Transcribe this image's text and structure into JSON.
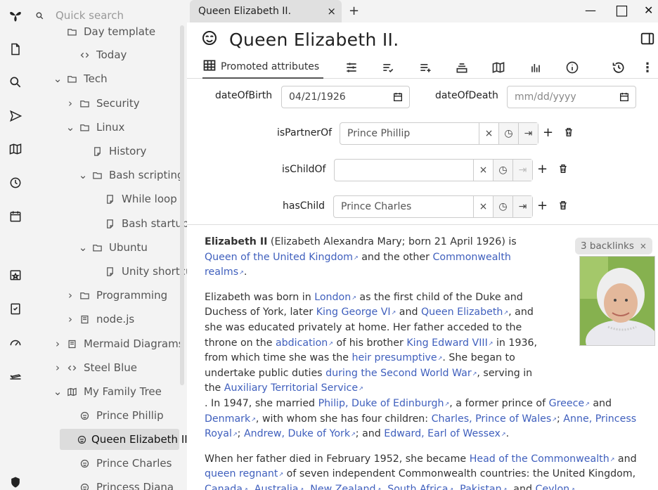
{
  "search": {
    "placeholder": "Quick search"
  },
  "tree": {
    "items": [
      {
        "label": "Day template"
      },
      {
        "label": "Today"
      },
      {
        "label": "Tech"
      },
      {
        "label": "Security"
      },
      {
        "label": "Linux"
      },
      {
        "label": "History"
      },
      {
        "label": "Bash scripting"
      },
      {
        "label": "While loop"
      },
      {
        "label": "Bash startup"
      },
      {
        "label": "Ubuntu"
      },
      {
        "label": "Unity shortcuts"
      },
      {
        "label": "Programming"
      },
      {
        "label": "node.js"
      },
      {
        "label": "Mermaid Diagrams"
      },
      {
        "label": "Steel Blue"
      },
      {
        "label": "My Family Tree"
      },
      {
        "label": "Prince Phillip"
      },
      {
        "label": "Queen Elizabeth II."
      },
      {
        "label": "Prince Charles"
      },
      {
        "label": "Princess Diana"
      }
    ]
  },
  "tab": {
    "title": "Queen Elizabeth II.",
    "close": "×",
    "add": "+"
  },
  "window": {
    "minimize": "—",
    "maximize": "□",
    "close": "✕"
  },
  "note": {
    "title": "Queen Elizabeth II."
  },
  "ribbon": {
    "promoted_label": "Promoted attributes"
  },
  "attributes": {
    "dateOfBirth": {
      "label": "dateOfBirth",
      "value": "04/21/1926"
    },
    "dateOfDeath": {
      "label": "dateOfDeath",
      "placeholder": "mm/dd/yyyy"
    },
    "isPartnerOf": {
      "label": "isPartnerOf",
      "value": "Prince Phillip"
    },
    "isChildOf": {
      "label": "isChildOf",
      "value": ""
    },
    "hasChild": {
      "label": "hasChild",
      "value": "Prince Charles"
    },
    "clear": "×",
    "add": "+"
  },
  "backlinks": {
    "label": "3 backlinks",
    "close": "×"
  },
  "content": {
    "p1": {
      "bold": "Elizabeth II",
      "t1": " (Elizabeth Alexandra Mary; born 21 April 1926) is ",
      "l1": "Queen of the United Kingdom",
      "t2": " and the other ",
      "l2": "Commonwealth realms",
      "t3": "."
    },
    "p2": {
      "t1": "Elizabeth was born in ",
      "l1": "London",
      "t2": " as the first child of the Duke and Duchess of York, later ",
      "l2": "King George VI",
      "t3": " and ",
      "l3": "Queen Elizabeth",
      "t4": ", and she was educated privately at home. Her father acceded to the throne on the ",
      "l4": "abdication",
      "t5": " of his brother ",
      "l5": "King Edward VIII",
      "t6": " in 1936, from which time she was the ",
      "l6": "heir presumptive",
      "t7": ". She began to undertake public duties ",
      "l7": "during the Second World War",
      "t8": ", serving in the ",
      "l8": "Auxiliary Territorial Service",
      "t9": ". In 1947, she married ",
      "l9": "Philip, Duke of Edinburgh",
      "t10": ", a former prince of ",
      "l10": "Greece",
      "t11": " and ",
      "l11": "Denmark",
      "t12": ", with whom she has four children: ",
      "l12": "Charles, Prince of Wales",
      "t13": "; ",
      "l13": "Anne, Princess Royal",
      "t14": "; ",
      "l14": "Andrew, Duke of York",
      "t15": "; and ",
      "l15": "Edward, Earl of Wessex",
      "t16": "."
    },
    "p3": {
      "t1": "When her father died in February 1952, she became ",
      "l1": "Head of the Commonwealth",
      "t2": " and ",
      "l2": "queen regnant",
      "t3": " of seven independent Commonwealth countries: the United Kingdom, ",
      "l3": "Canada",
      "t4": ", ",
      "l4": "Australia",
      "t5": ", ",
      "l5": "New Zealand",
      "t6": ", ",
      "l6": "South Africa",
      "t7": ", ",
      "l7": "Pakistan",
      "t8": ", and ",
      "l8": "Ceylon",
      "t9": "."
    }
  }
}
